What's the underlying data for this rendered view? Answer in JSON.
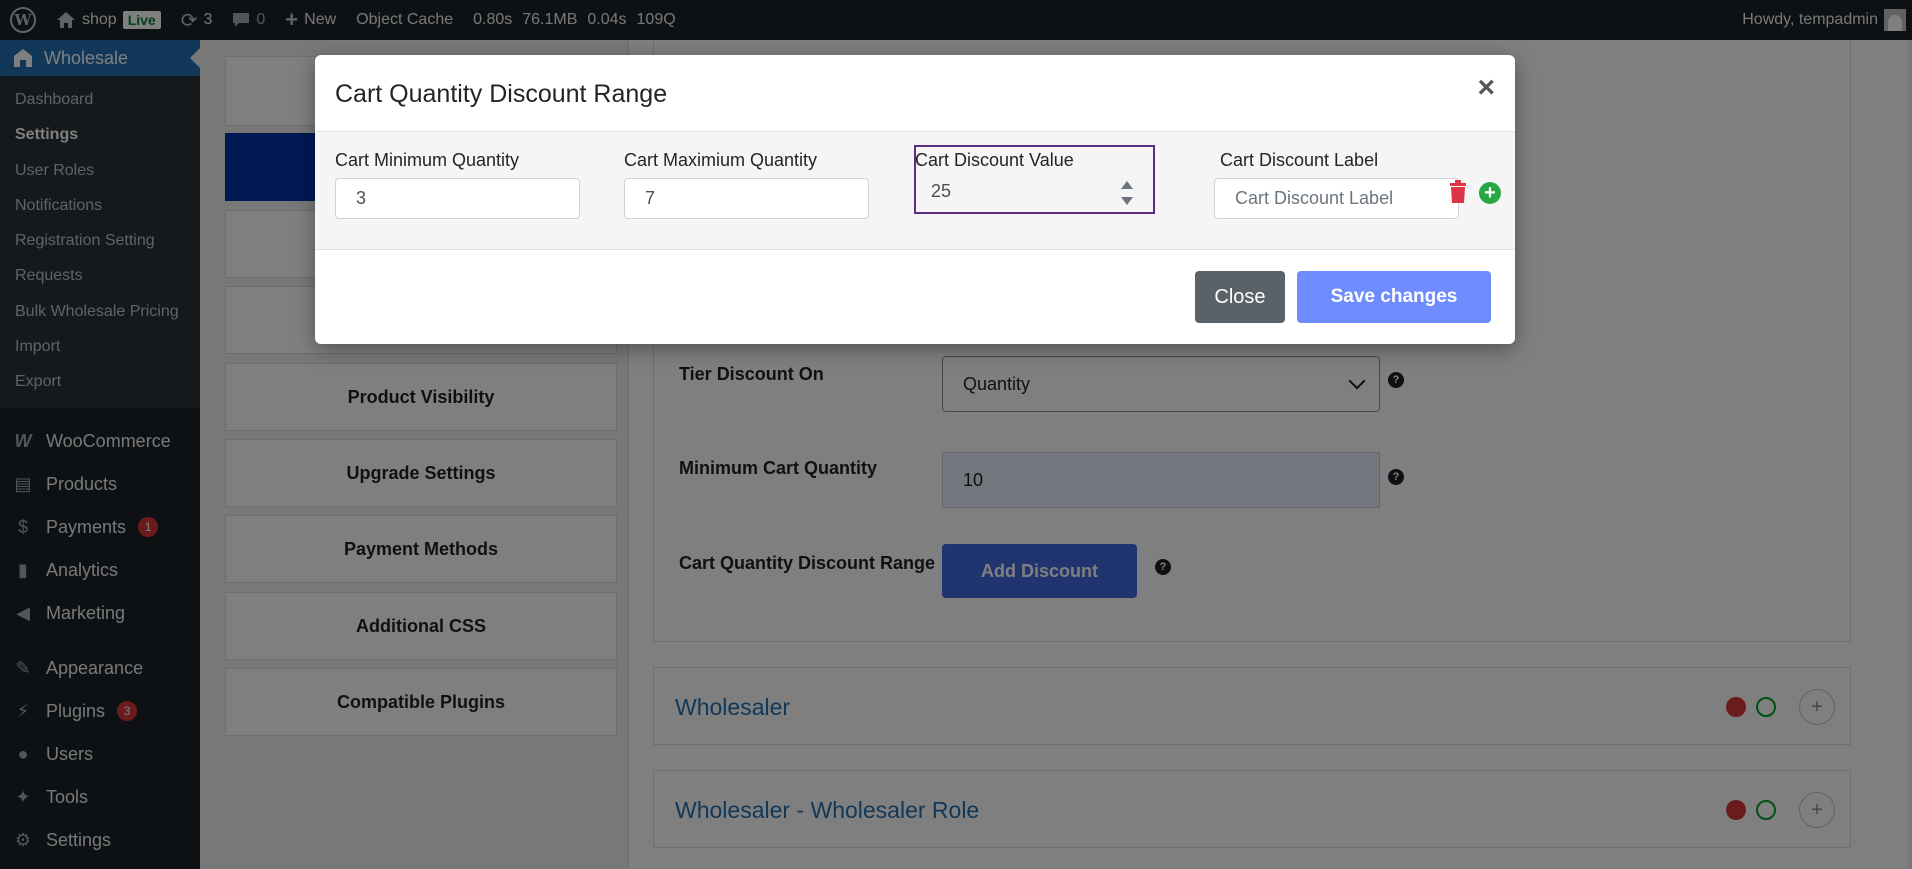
{
  "adminbar": {
    "site_name": "shop",
    "live_badge": "Live",
    "updates_count": "3",
    "comments_count": "0",
    "new_label": "New",
    "object_cache": "Object Cache",
    "perf_time": "0.80s",
    "perf_memory": "76.1MB",
    "perf_db_time": "0.04s",
    "perf_queries": "109Q",
    "greeting": "Howdy, tempadmin"
  },
  "sidebar": {
    "active_menu": "Wholesale",
    "submenu": [
      {
        "label": "Dashboard"
      },
      {
        "label": "Settings"
      },
      {
        "label": "User Roles"
      },
      {
        "label": "Notifications"
      },
      {
        "label": "Registration Setting"
      },
      {
        "label": "Requests"
      },
      {
        "label": "Bulk Wholesale Pricing"
      },
      {
        "label": "Import"
      },
      {
        "label": "Export"
      }
    ],
    "menu": [
      {
        "label": "WooCommerce",
        "icon": "woo-icon"
      },
      {
        "label": "Products",
        "icon": "archive-icon"
      },
      {
        "label": "Payments",
        "icon": "dollar-icon",
        "badge": "1"
      },
      {
        "label": "Analytics",
        "icon": "bar-chart-icon"
      },
      {
        "label": "Marketing",
        "icon": "megaphone-icon"
      },
      {
        "label": "Appearance",
        "icon": "brush-icon"
      },
      {
        "label": "Plugins",
        "icon": "plugin-icon",
        "badge": "3"
      },
      {
        "label": "Users",
        "icon": "user-icon"
      },
      {
        "label": "Tools",
        "icon": "wrench-icon"
      },
      {
        "label": "Settings",
        "icon": "settings-icon"
      }
    ]
  },
  "tabs": [
    {
      "label": "Product Visibility"
    },
    {
      "label": "Upgrade Settings"
    },
    {
      "label": "Payment Methods"
    },
    {
      "label": "Additional CSS"
    },
    {
      "label": "Compatible Plugins"
    }
  ],
  "settings": {
    "tier_label": "Tier Discount On",
    "tier_value": "Quantity",
    "min_cart_label": "Minimum Cart Quantity",
    "min_cart_value": "10",
    "range_label": "Cart Quantity Discount Range",
    "add_discount": "Add Discount"
  },
  "roles": [
    {
      "title": "Wholesaler"
    },
    {
      "title": "Wholesaler - Wholesaler Role"
    }
  ],
  "modal": {
    "title": "Cart Quantity Discount Range",
    "close_symbol": "×",
    "fields": {
      "min_label": "Cart Minimum Quantity",
      "min_value": "3",
      "max_label": "Cart Maximium Quantity",
      "max_value": "7",
      "value_label": "Cart Discount Value",
      "value_value": "25",
      "disc_label": "Cart Discount Label",
      "disc_placeholder": "Cart Discount Label"
    },
    "close_button": "Close",
    "save_button": "Save changes"
  }
}
